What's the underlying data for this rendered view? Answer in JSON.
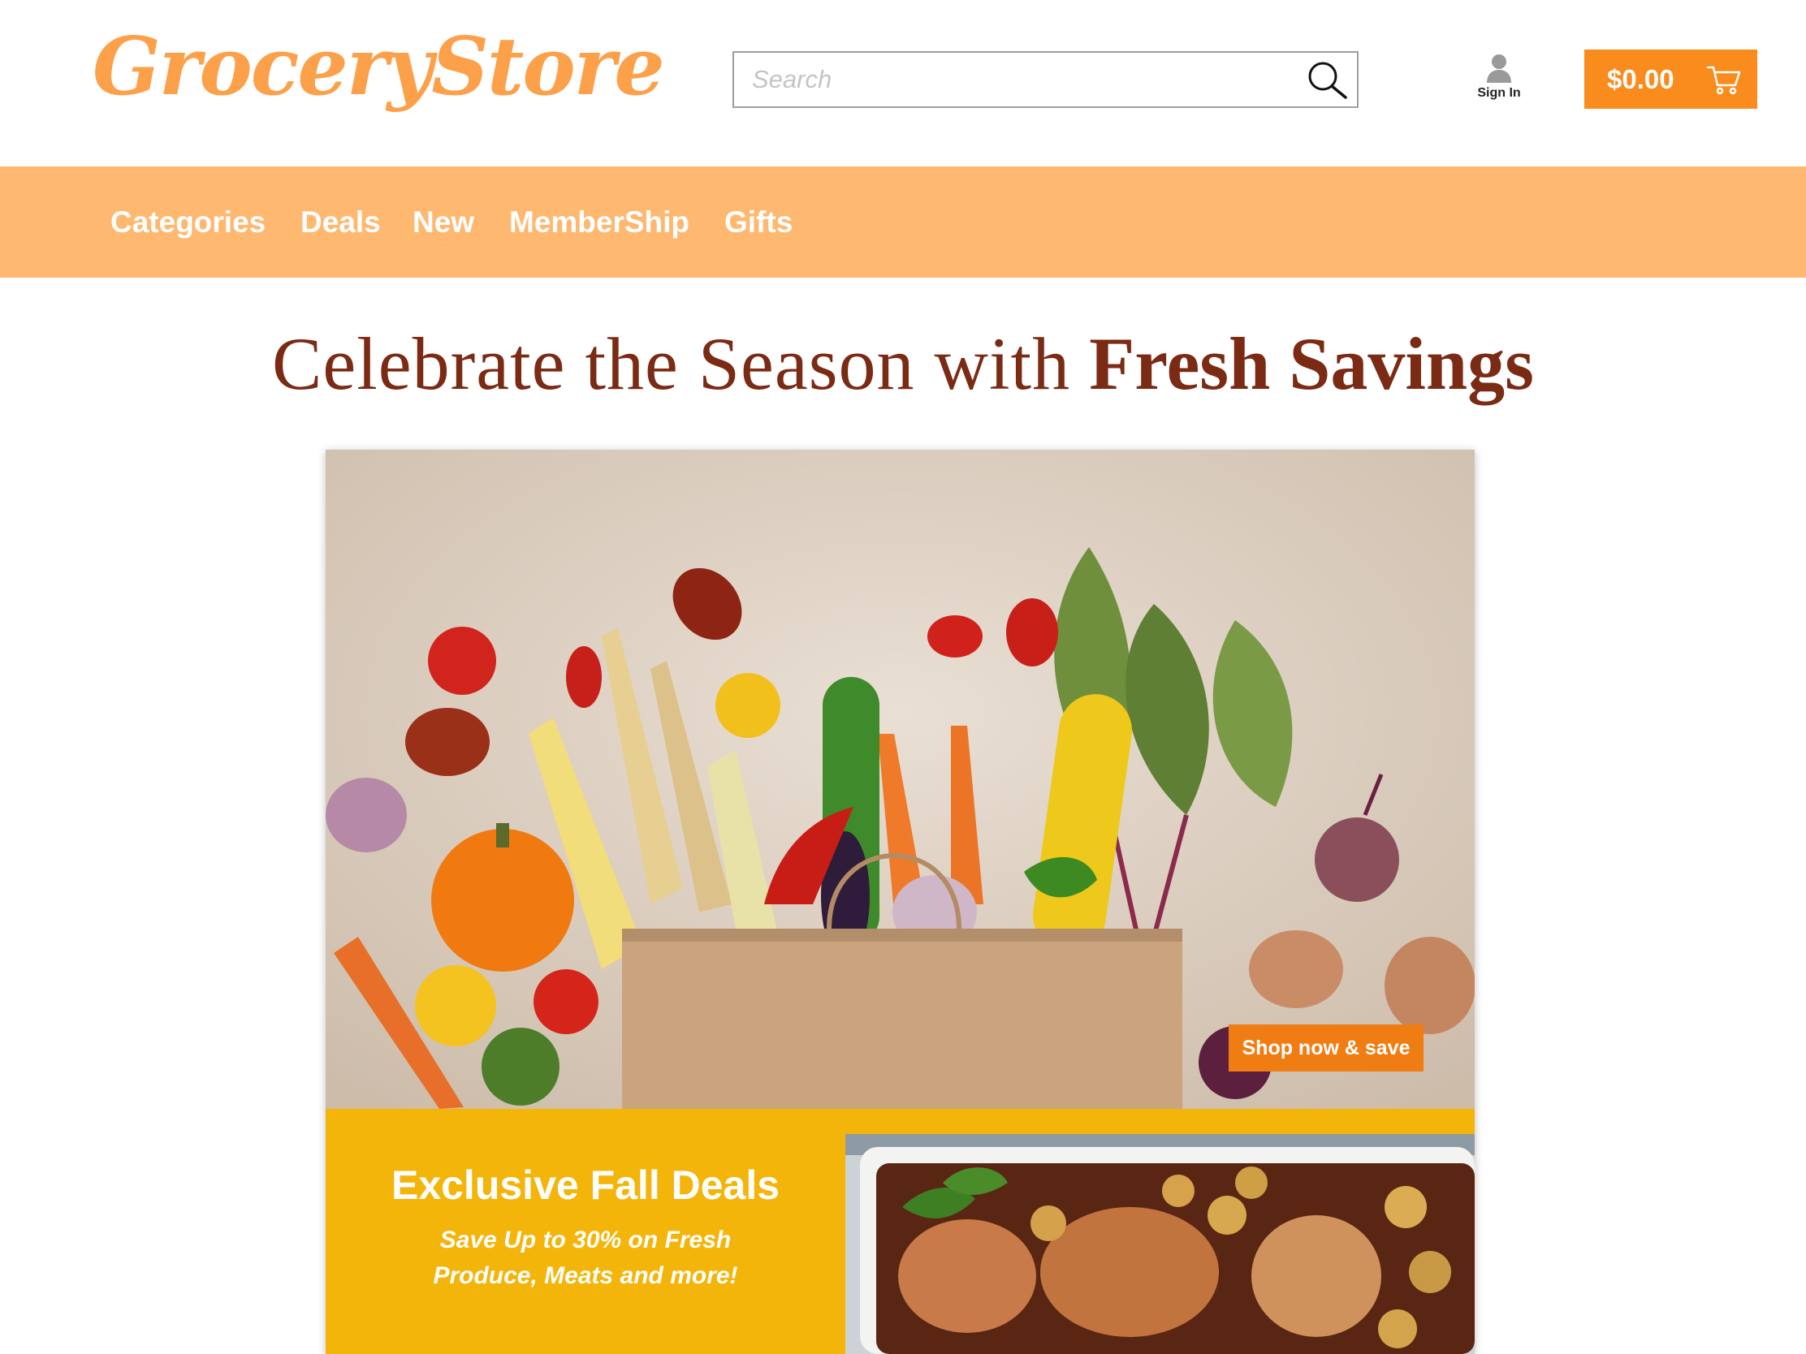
{
  "header": {
    "logo": "GroceryStore",
    "search": {
      "placeholder": "Search",
      "value": ""
    },
    "sign_in_label": "Sign In",
    "cart_total": "$0.00"
  },
  "nav": {
    "items": [
      {
        "label": "Categories"
      },
      {
        "label": "Deals"
      },
      {
        "label": "New"
      },
      {
        "label": "MemberShip"
      },
      {
        "label": "Gifts"
      }
    ]
  },
  "headline": {
    "part1": "Celebrate the Season with",
    "part2": "Fresh Savings"
  },
  "hero": {
    "shop_button": "Shop now & save",
    "deal_title": "Exclusive Fall Deals",
    "deal_subtitle": "Save Up to 30% on Fresh Produce, Meats and more!"
  },
  "colors": {
    "brand_orange": "#fca04a",
    "nav_bar": "#ffb870",
    "cart_button": "#f98c1d",
    "headline": "#7b2a14",
    "deal_panel": "#f4b50a",
    "shop_button": "#f07d14"
  },
  "icons": {
    "search": "magnifier-icon",
    "user": "user-icon",
    "cart": "shopping-cart-icon"
  }
}
